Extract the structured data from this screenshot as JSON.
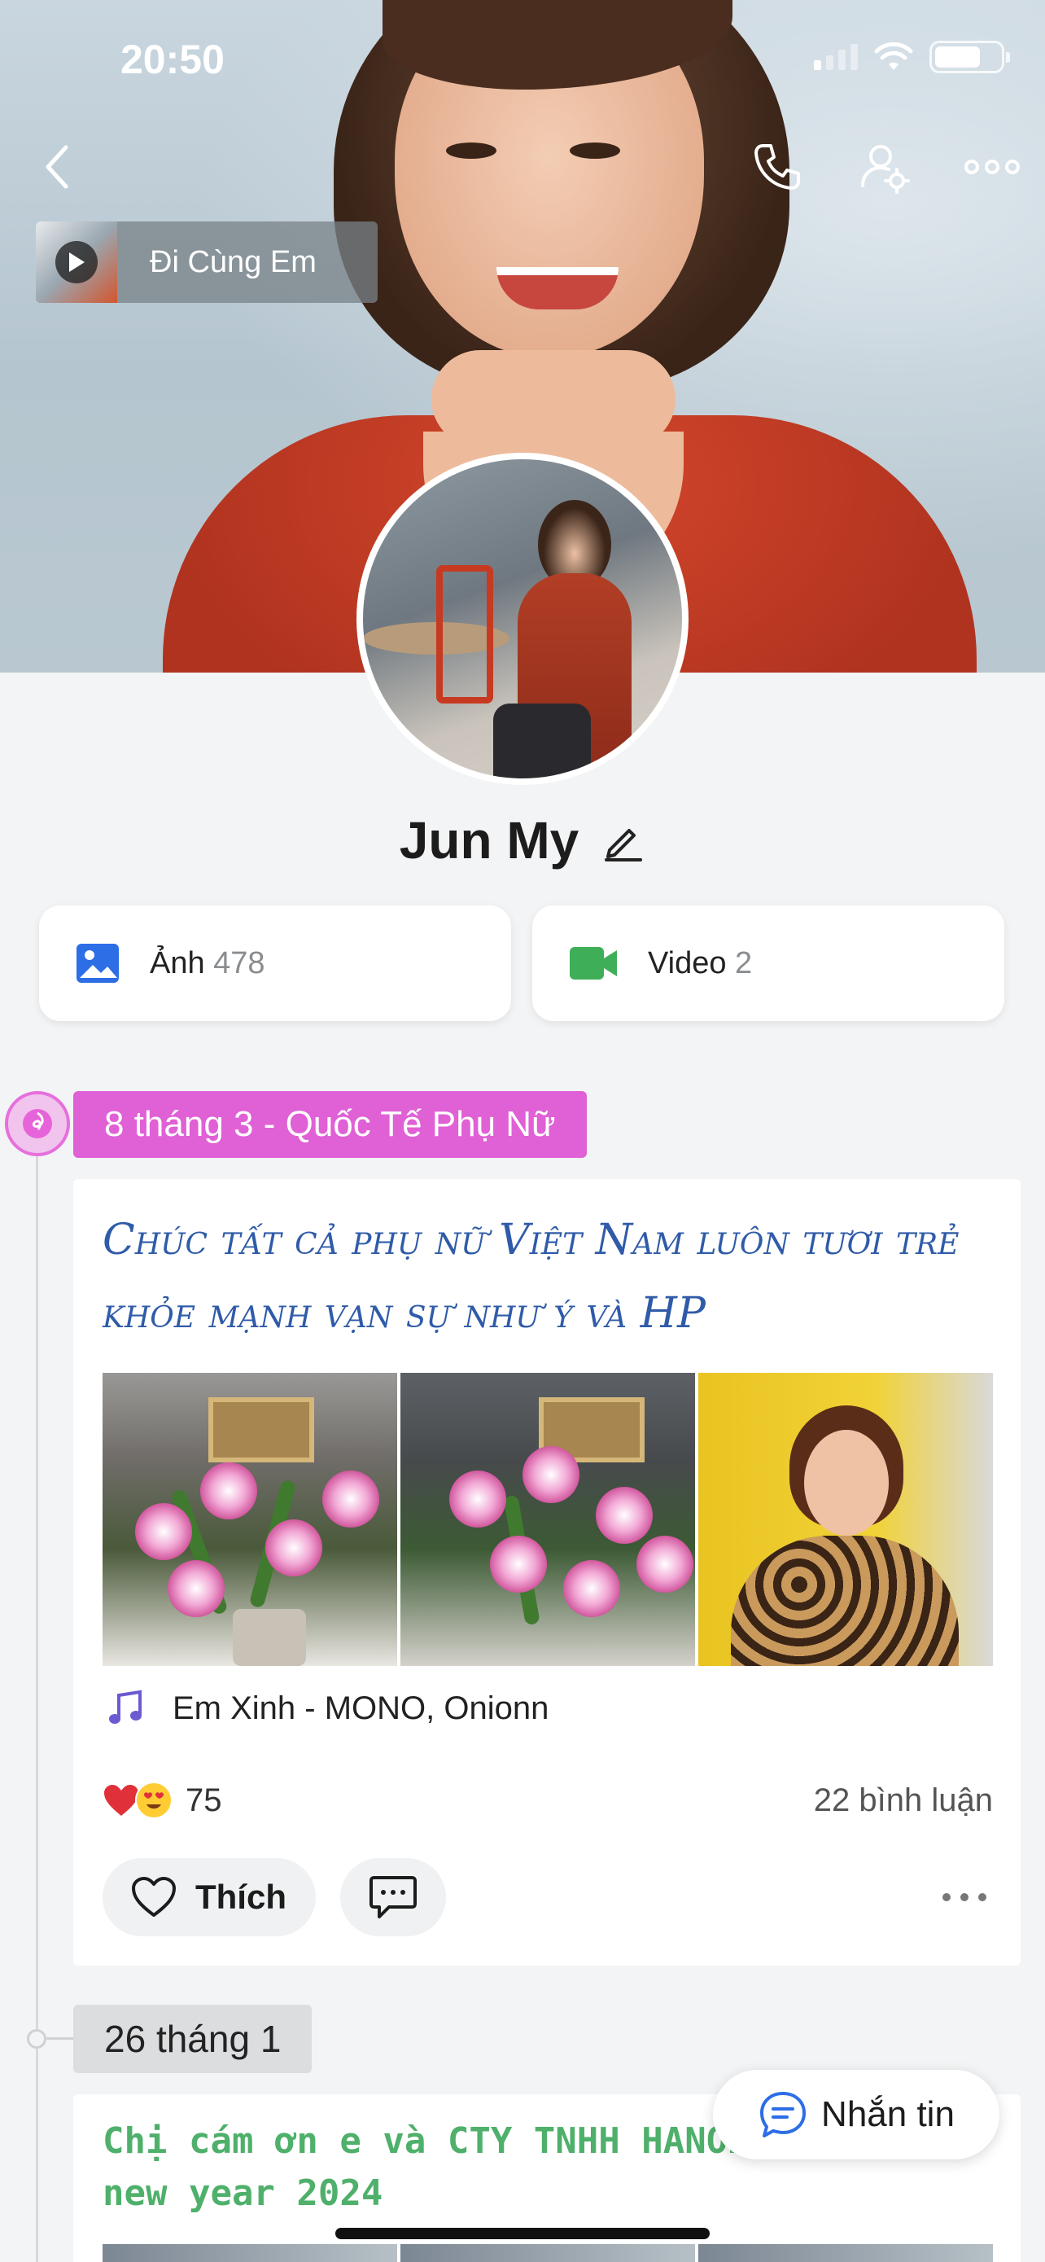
{
  "status_bar": {
    "time": "20:50",
    "battery_percent": 70
  },
  "header": {
    "music_chip": {
      "title": "Đi Cùng Em"
    }
  },
  "profile": {
    "name": "Jun My",
    "photos": {
      "label": "Ảnh",
      "count": "478"
    },
    "videos": {
      "label": "Video",
      "count": "2"
    }
  },
  "timeline": {
    "event_tag": "8 tháng 3 - Quốc Tế Phụ Nữ",
    "post1": {
      "text": "Chúc tất cả phụ nữ Việt Nam luôn tươi trẻ khỏe mạnh vạn sự như ý và HP",
      "song": "Em Xinh - MONO, Onionn",
      "reaction_count": "75",
      "comment_count": "22 bình luận",
      "like_label": "Thích"
    },
    "date_tag": "26 tháng 1",
    "post2": {
      "text": "Chị cám ơn e và CTY TNHH HANOB\nnew year 2024"
    }
  },
  "message_button": {
    "label": "Nhắn tin"
  },
  "colors": {
    "event_tag": "#e060d6",
    "post_text": "#2f5ba8",
    "post2_text": "#4fb06b",
    "photos_icon": "#2d6ee6",
    "videos_icon": "#3fae58",
    "message_icon": "#2d6ee6"
  }
}
